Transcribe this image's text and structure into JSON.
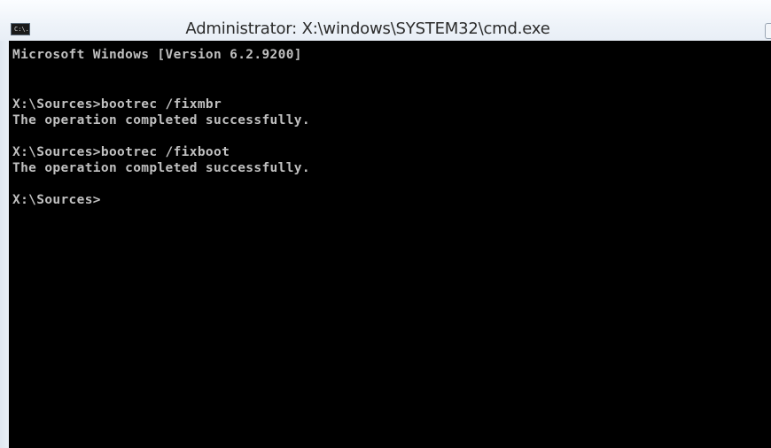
{
  "window": {
    "title": "Administrator: X:\\windows\\SYSTEM32\\cmd.exe",
    "icon": "console-app-icon",
    "icon_glyph": "C:\\."
  },
  "console": {
    "lines": [
      "Microsoft Windows [Version 6.2.9200]",
      "",
      "X:\\Sources>bootrec /fixmbr",
      "The operation completed successfully.",
      "",
      "X:\\Sources>bootrec /fixboot",
      "The operation completed successfully.",
      "",
      "X:\\Sources>"
    ],
    "background": "#000000",
    "foreground": "#c0c0c0"
  }
}
